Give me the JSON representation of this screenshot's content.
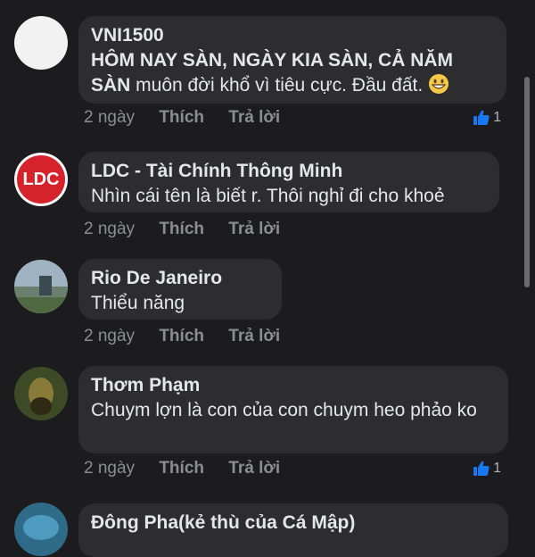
{
  "comments": [
    {
      "name": "VNI1500",
      "text_bold": "HÔM NAY SÀN, NGÀY KIA SÀN, CẢ NĂM SÀN",
      "text": " muôn đời khổ vì tiêu cực. Đầu đất.",
      "emoji": "grinning-face-emoji",
      "time": "2 ngày",
      "like_label": "Thích",
      "reply_label": "Trả lời",
      "like_count": "1"
    },
    {
      "name": "LDC - Tài Chính Thông Minh",
      "avatar_text": "LDC",
      "text": "Nhìn cái tên là biết r. Thôi nghỉ đi cho khoẻ",
      "time": "2 ngày",
      "like_label": "Thích",
      "reply_label": "Trả lời"
    },
    {
      "name": "Rio De Janeiro",
      "text": "Thiểu năng",
      "time": "2 ngày",
      "like_label": "Thích",
      "reply_label": "Trả lời"
    },
    {
      "name": "Thơm Phạm",
      "text": "Chuym lợn là con của con chuym heo phảo ko",
      "time": "2 ngày",
      "like_label": "Thích",
      "reply_label": "Trả lời",
      "like_count": "1"
    },
    {
      "name": "Đông Pha(kẻ thù của Cá Mập)"
    }
  ],
  "colors": {
    "background": "#1c1c1e",
    "bubble": "#2d2d2f",
    "like_blue": "#1877f2",
    "ldc_red": "#d6232b"
  }
}
